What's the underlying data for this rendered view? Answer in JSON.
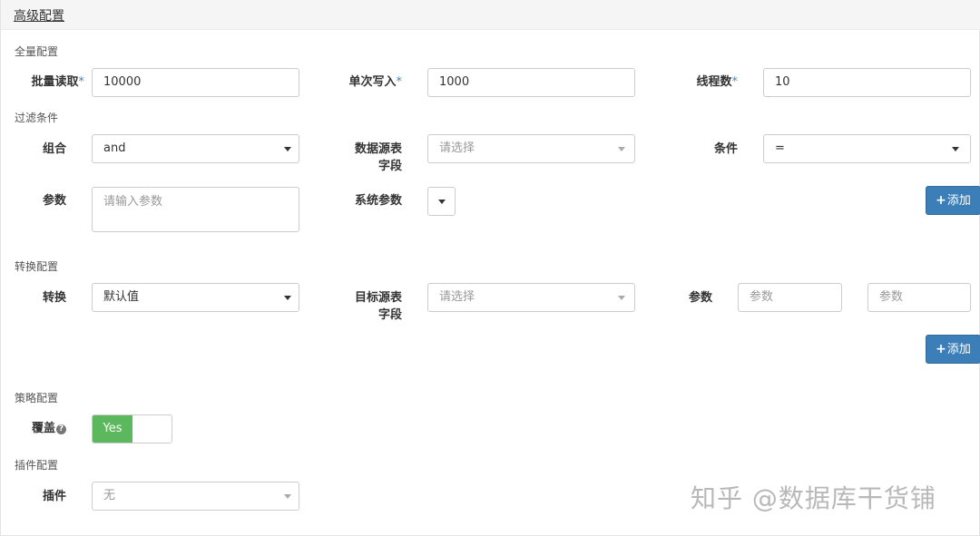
{
  "panel": {
    "title": "高级配置"
  },
  "sections": {
    "global": "全量配置",
    "filter": "过滤条件",
    "transform": "转换配置",
    "strategy": "策略配置",
    "plugin": "插件配置"
  },
  "global": {
    "batch_read_label": "批量读取",
    "batch_read_value": "10000",
    "single_write_label": "单次写入",
    "single_write_value": "1000",
    "threads_label": "线程数",
    "threads_value": "10",
    "required_mark": "*"
  },
  "filter": {
    "combine_label": "组合",
    "combine_value": "and",
    "source_field_label_1": "数据源表",
    "source_field_label_2": "字段",
    "source_field_placeholder": "请选择",
    "condition_label": "条件",
    "condition_value": "=",
    "param_label": "参数",
    "param_placeholder": "请输入参数",
    "sys_param_label": "系统参数",
    "add_label": "添加"
  },
  "transform": {
    "transform_label": "转换",
    "transform_value": "默认值",
    "target_field_label_1": "目标源表",
    "target_field_label_2": "字段",
    "target_field_placeholder": "请选择",
    "param_label": "参数",
    "param1_placeholder": "参数",
    "param2_placeholder": "参数",
    "add_label": "添加"
  },
  "strategy": {
    "overwrite_label": "覆盖",
    "help_icon": "?",
    "toggle_on": "Yes"
  },
  "plugin": {
    "plugin_label": "插件",
    "plugin_value": "无"
  },
  "watermark": "知乎 @数据库干货铺"
}
